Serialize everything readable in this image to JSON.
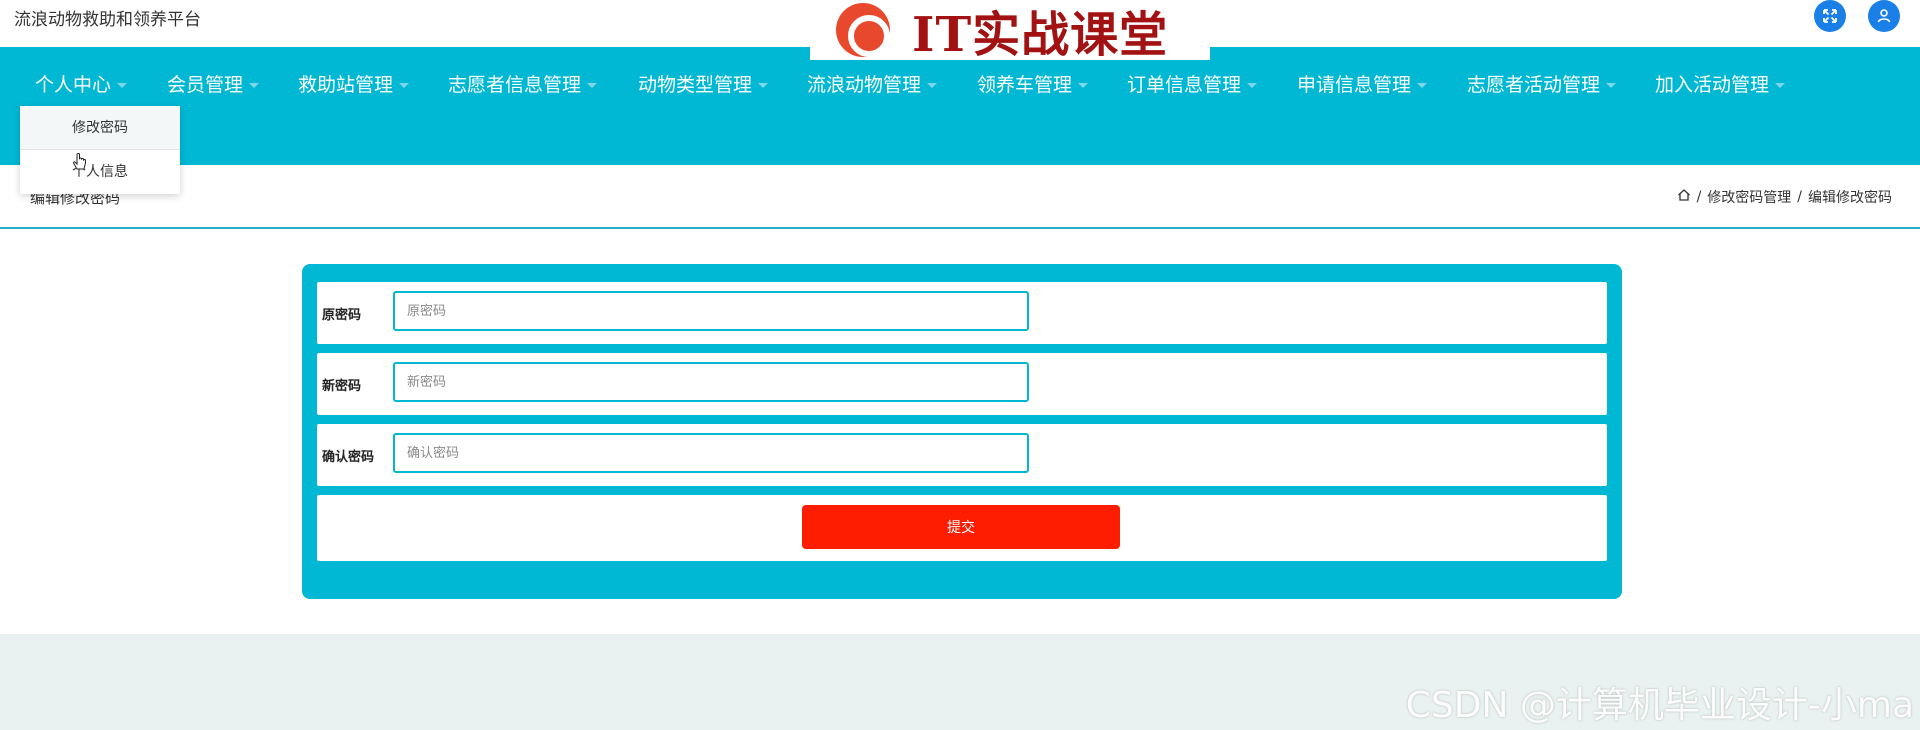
{
  "header": {
    "site_title": "流浪动物救助和领养平台",
    "banner_text": "IT实战课堂",
    "icons": [
      "expand-icon",
      "user-icon"
    ]
  },
  "nav": {
    "items": [
      {
        "label": "个人中心"
      },
      {
        "label": "会员管理"
      },
      {
        "label": "救助站管理"
      },
      {
        "label": "志愿者信息管理"
      },
      {
        "label": "动物类型管理"
      },
      {
        "label": "流浪动物管理"
      },
      {
        "label": "领养车管理"
      },
      {
        "label": "订单信息管理"
      },
      {
        "label": "申请信息管理"
      },
      {
        "label": "志愿者活动管理"
      },
      {
        "label": "加入活动管理"
      }
    ],
    "dropdown": {
      "items": [
        {
          "label": "修改密码"
        },
        {
          "label": "个人信息"
        }
      ]
    }
  },
  "titlebar": {
    "page_title": "编辑修改密码",
    "breadcrumb": [
      "修改密码管理",
      "编辑修改密码"
    ],
    "separator": "/"
  },
  "form": {
    "fields": [
      {
        "label": "原密码",
        "placeholder": "原密码",
        "value": ""
      },
      {
        "label": "新密码",
        "placeholder": "新密码",
        "value": ""
      },
      {
        "label": "确认密码",
        "placeholder": "确认密码",
        "value": ""
      }
    ],
    "submit_label": "提交"
  },
  "watermark": "CSDN @计算机毕业设计-小ma",
  "colors": {
    "accent": "#00b8d4",
    "submit": "#ff1d00",
    "banner_text": "#a31212",
    "icon_blue": "#1a7fe6"
  }
}
